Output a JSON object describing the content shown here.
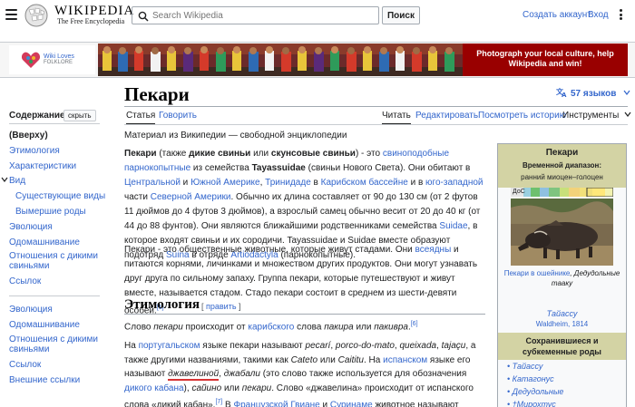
{
  "header": {
    "wordmark": "Wikipedia",
    "tagline": "The Free Encyclopedia",
    "search_placeholder": "Search Wikipedia",
    "search_button": "Поиск",
    "create_account": "Создать аккаунт",
    "login": "Вход"
  },
  "banner": {
    "logo_line1": "Wiki Loves",
    "logo_line2": "FOLKLORE",
    "cta_line1": "Photograph your local culture, help",
    "cta_line2": "Wikipedia and win!",
    "cta_color": "#990000"
  },
  "article": {
    "title": "Пекари",
    "languages": "57 языков",
    "tabs_left": [
      "Статья",
      "Говорить"
    ],
    "tabs_right": [
      "Читать",
      "Редактировать",
      "Посмотреть историю",
      "Инструменты"
    ],
    "subtitle": "Материал из Википедии — свободной энциклопедии",
    "section_heading": "Этимология",
    "section_edit": "править"
  },
  "toc": {
    "heading": "Содержание",
    "hide_button": "скрыть",
    "items": [
      "(Вверху)",
      "Этимология",
      "Характеристики",
      "Вид",
      "Существующие виды",
      "Вымершие роды",
      "Эволюция",
      "Одомашнивание",
      "Отношения с дикими свиньями",
      "Ссылок",
      "Эволюция",
      "Одомашнивание",
      "Отношения с дикими свиньями",
      "Ссылок",
      "Внешние ссылки"
    ]
  },
  "infobox": {
    "title": "Пекари",
    "range_label": "Временной диапазон:",
    "range_value": "ранний миоцен–голоцен",
    "timebar_label": "ДоС",
    "caption_link": "Пекари в ошейнике",
    "caption_rest": ", Дедудольные тааку",
    "taxon_link": "Тайассу",
    "authority": "Waldheim, 1814",
    "section_subfamilies": "Сохранившиеся и субкеменные роды",
    "genera": [
      "Тайассу",
      "Катагонус",
      "Дедудольные",
      "Мирохтус"
    ]
  },
  "colors": {
    "link": "#3366cc",
    "infobox_header": "#d3d3a4",
    "underline_red": "#d73333"
  }
}
